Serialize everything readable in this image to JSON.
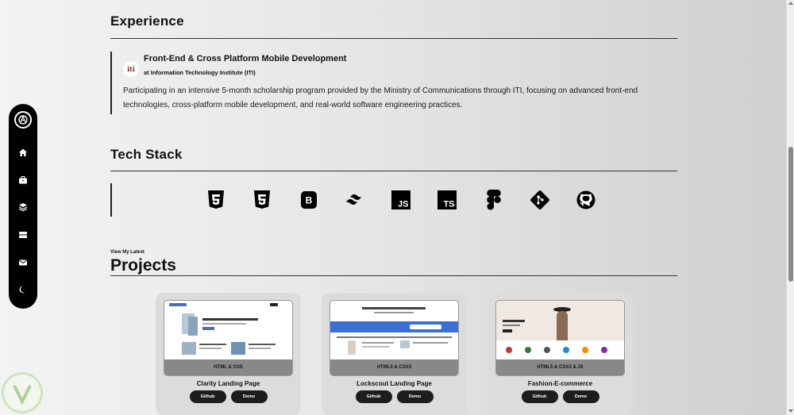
{
  "experience": {
    "title": "Experience",
    "role": "Front-End & Cross Platform Mobile Development",
    "org": "at Information Technology Institute (ITI)",
    "logo_text": "iti",
    "description": "Participating in an intensive 5-month scholarship program provided by the Ministry of Communications through ITI, focusing on advanced front-end technologies, cross-platform mobile development, and real-world software engineering practices."
  },
  "tech_stack": {
    "title": "Tech Stack",
    "icons": [
      "html5-icon",
      "css3-icon",
      "bootstrap-icon",
      "tailwind-icon",
      "javascript-icon",
      "typescript-icon",
      "figma-icon",
      "git-icon",
      "github-icon"
    ],
    "js_label": "JS",
    "ts_label": "TS",
    "bootstrap_label": "B"
  },
  "projects": {
    "eyebrow": "View My Latest",
    "title": "Projects",
    "items": [
      {
        "name": "Clarity Landing Page",
        "tech": "HTML & CSS",
        "github": "Github",
        "demo": "Demo"
      },
      {
        "name": "Lockscout Landing Page",
        "tech": "HTML5 & CSS3",
        "github": "Github",
        "demo": "Demo"
      },
      {
        "name": "Fashion-E-commerce",
        "tech": "HTML5 & CSS3 & JS",
        "github": "Github",
        "demo": "Demo"
      }
    ]
  },
  "sidebar": {
    "items": [
      "home-icon",
      "briefcase-icon",
      "layers-icon",
      "server-icon",
      "mail-icon",
      "moon-icon"
    ]
  },
  "colors": {
    "accent": "#000000",
    "brand_red": "#8b1a1a"
  }
}
